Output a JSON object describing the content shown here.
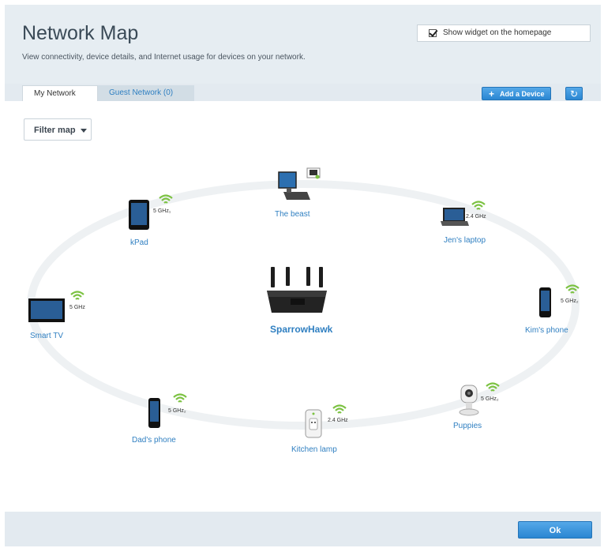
{
  "header": {
    "title": "Network Map",
    "subtitle": "View connectivity, device details, and Internet usage for devices on your network.",
    "widget_label": "Show widget on the homepage",
    "widget_checked": true
  },
  "tabs": [
    {
      "label": "My Network",
      "active": true
    },
    {
      "label": "Guest Network (0)",
      "active": false
    }
  ],
  "toolbar": {
    "add_device_label": "Add a Device",
    "refresh_icon": "refresh-icon"
  },
  "filter": {
    "label": "Filter map"
  },
  "router": {
    "name": "SparrowHawk"
  },
  "devices": [
    {
      "name": "The beast",
      "band": "",
      "type": "desktop"
    },
    {
      "name": "kPad",
      "band": "5 GHz₁",
      "type": "tablet"
    },
    {
      "name": "Jen's laptop",
      "band": "2.4 GHz",
      "type": "laptop"
    },
    {
      "name": "Smart TV",
      "band": "5 GHz",
      "type": "tv"
    },
    {
      "name": "Kim's phone",
      "band": "5 GHz₂",
      "type": "phone"
    },
    {
      "name": "Dad's phone",
      "band": "5 GHz₂",
      "type": "phone"
    },
    {
      "name": "Kitchen lamp",
      "band": "2.4 GHz",
      "type": "plug"
    },
    {
      "name": "Puppies",
      "band": "5 GHz₂",
      "type": "camera"
    }
  ],
  "footer": {
    "ok_label": "Ok"
  },
  "colors": {
    "accent": "#2f7fc1",
    "wifi": "#7cc242"
  }
}
